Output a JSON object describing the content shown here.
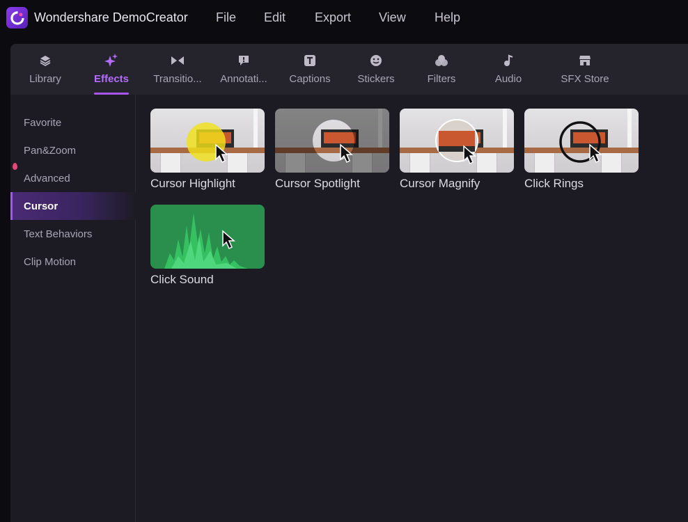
{
  "app": {
    "title": "Wondershare DemoCreator"
  },
  "menu": [
    "File",
    "Edit",
    "Export",
    "View",
    "Help"
  ],
  "tabs": [
    {
      "label": "Library",
      "icon": "layers-icon",
      "active": false
    },
    {
      "label": "Effects",
      "icon": "sparkle-icon",
      "active": true
    },
    {
      "label": "Transitio...",
      "icon": "transition-icon",
      "active": false
    },
    {
      "label": "Annotati...",
      "icon": "annotation-icon",
      "active": false
    },
    {
      "label": "Captions",
      "icon": "captions-icon",
      "active": false
    },
    {
      "label": "Stickers",
      "icon": "sticker-icon",
      "active": false
    },
    {
      "label": "Filters",
      "icon": "filters-icon",
      "active": false
    },
    {
      "label": "Audio",
      "icon": "music-note-icon",
      "active": false
    },
    {
      "label": "SFX Store",
      "icon": "store-icon",
      "active": false
    }
  ],
  "sidebar": [
    {
      "label": "Favorite",
      "active": false
    },
    {
      "label": "Pan&Zoom",
      "active": false
    },
    {
      "label": "Advanced",
      "active": false
    },
    {
      "label": "Cursor",
      "active": true
    },
    {
      "label": "Text Behaviors",
      "active": false
    },
    {
      "label": "Clip Motion",
      "active": false
    }
  ],
  "effects": [
    {
      "label": "Cursor Highlight"
    },
    {
      "label": "Cursor Spotlight"
    },
    {
      "label": "Cursor Magnify"
    },
    {
      "label": "Click Rings"
    },
    {
      "label": "Click Sound"
    }
  ],
  "colors": {
    "accent": "#a855f7",
    "highlight": "#f2e21a",
    "sound_bg": "#2a8f4d"
  }
}
